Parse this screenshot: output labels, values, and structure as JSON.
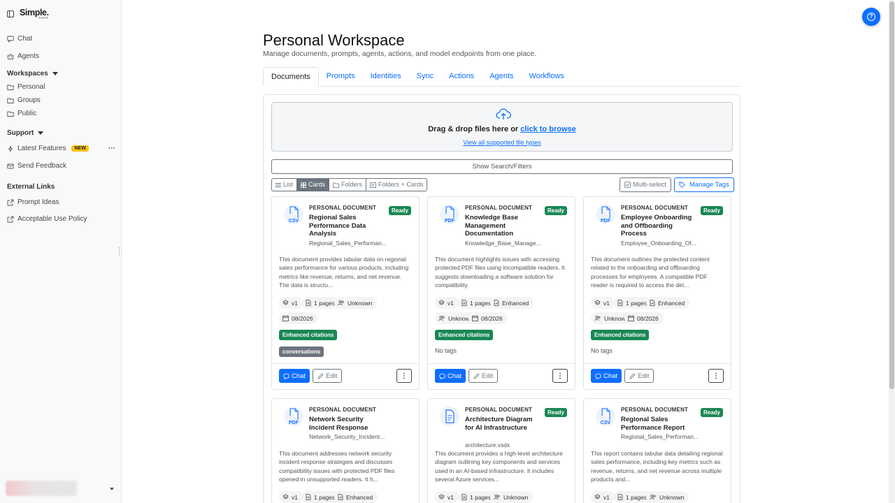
{
  "brand": {
    "name": "Simple.",
    "sub": "CHAT"
  },
  "sidebar": {
    "chat": "Chat",
    "agents": "Agents",
    "workspaces": {
      "label": "Workspaces",
      "items": [
        "Personal",
        "Groups",
        "Public"
      ]
    },
    "support": {
      "label": "Support",
      "latest": "Latest Features",
      "new_badge": "NEW",
      "feedback": "Send Feedback"
    },
    "external": {
      "label": "External Links",
      "items": [
        "Prompt Ideas",
        "Acceptable Use Policy"
      ]
    }
  },
  "page": {
    "title": "Personal Workspace",
    "subtitle": "Manage documents, prompts, agents, actions, and model endpoints from one place.",
    "tabs": [
      "Documents",
      "Prompts",
      "Identities",
      "Sync",
      "Actions",
      "Agents",
      "Workflows"
    ]
  },
  "upload": {
    "text": "Drag & drop files here or ",
    "browse": "click to browse",
    "types_link": "View all supported file types"
  },
  "toolbar": {
    "search_toggle": "Show Search/Filters",
    "views": [
      "List",
      "Cards",
      "Folders",
      "Folders + Cards"
    ],
    "multiselect": "Multi-select",
    "manage_tags": "Manage Tags"
  },
  "labels": {
    "chat": "Chat",
    "edit": "Edit",
    "no_tags": "No tags",
    "enhanced_citations": "Enhanced citations"
  },
  "colors": {
    "accent": "#0d6efd",
    "success": "#198754",
    "secondary": "#6c757d"
  },
  "cards": [
    {
      "type": "PERSONAL DOCUMENT",
      "status": "Ready",
      "icon": "csv-file-icon",
      "ext": "CSV",
      "title": "Regional Sales Performance Data Analysis",
      "filename": "Regional_Sales_Performan...",
      "description": "This document provides tabular data on regional sales performance for various products, including metrics like revenue, returns, and net revenue. The data is structu...",
      "version": "v1",
      "pages": "1 pages",
      "chips2": [
        "Unknown"
      ],
      "date": "08/2026",
      "citations": "Enhanced citations",
      "tags": [
        "conversations"
      ]
    },
    {
      "type": "PERSONAL DOCUMENT",
      "status": "Ready",
      "icon": "pdf-file-icon",
      "ext": "PDF",
      "title": "Knowledge Base Management Documentation",
      "filename": "Knowledge_Base_Manage...",
      "description": "This document highlights issues with accessing protected PDF files using incompatible readers. It suggests downloading a software solution for compatibility.",
      "version": "v1",
      "pages": "1 pages",
      "enhanced": "Enhanced",
      "author": "Unknown",
      "date": "08/2026",
      "citations": "Enhanced citations",
      "tags": []
    },
    {
      "type": "PERSONAL DOCUMENT",
      "status": "Ready",
      "icon": "pdf-file-icon",
      "ext": "PDF",
      "title": "Employee Onboarding and Offboarding Process",
      "filename": "Employee_Onboarding_Of...",
      "description": "This document outlines the protected content related to the onboarding and offboarding processes for employees. A compatible PDF reader is required to access the det...",
      "version": "v1",
      "pages": "1 pages",
      "enhanced": "Enhanced",
      "author": "Unknown",
      "date": "08/2026",
      "citations": "Enhanced citations",
      "tags": []
    },
    {
      "type": "PERSONAL DOCUMENT",
      "status": "",
      "icon": "pdf-file-icon",
      "ext": "PDF",
      "title": "Network Security Incident Response",
      "filename": "Network_Security_Incident...",
      "description": "This document addresses network security incident response strategies and discusses compatibility issues with protected PDF files opened in unsupported readers. It h...",
      "version": "v1",
      "pages": "1 pages",
      "enhanced": "Enhanced"
    },
    {
      "type": "PERSONAL DOCUMENT",
      "status": "Ready",
      "icon": "vsdx-file-icon",
      "ext": "",
      "title": "Architecture Diagram for AI Infrastructure",
      "filename": "architecture.vsdx",
      "description": "This document provides a high-level architecture diagram outlining key components and services used in an AI-based infrastructure. It includes several Azure services...",
      "version": "v1",
      "pages": "1 pages",
      "author": "Unknown"
    },
    {
      "type": "PERSONAL DOCUMENT",
      "status": "Ready",
      "icon": "csv-file-icon",
      "ext": "CSV",
      "title": "Regional Sales Performance Report",
      "filename": "Regional_Sales_Performan...",
      "description": "This report contains tabular data detailing regional sales performance, including key metrics such as revenue, returns, and net revenue across multiple products and...",
      "version": "v1",
      "pages": "1 pages",
      "author": "Unknown"
    }
  ]
}
